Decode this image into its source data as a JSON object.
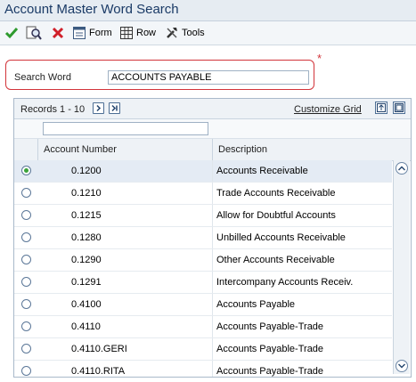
{
  "window": {
    "title": "Account Master Word Search"
  },
  "toolbar": {
    "form_label": "Form",
    "row_label": "Row",
    "tools_label": "Tools"
  },
  "search": {
    "label": "Search Word",
    "value": "ACCOUNTS PAYABLE",
    "required_marker": "*"
  },
  "grid": {
    "records_label": "Records 1 - 10",
    "customize_label": "Customize Grid",
    "columns": [
      "Account Number",
      "Description"
    ],
    "rows": [
      {
        "account": "0.1200",
        "description": "Accounts Receivable",
        "selected": true
      },
      {
        "account": "0.1210",
        "description": "Trade Accounts Receivable",
        "selected": false
      },
      {
        "account": "0.1215",
        "description": "Allow for Doubtful Accounts",
        "selected": false
      },
      {
        "account": "0.1280",
        "description": "Unbilled Accounts Receivable",
        "selected": false
      },
      {
        "account": "0.1290",
        "description": "Other Accounts Receivable",
        "selected": false
      },
      {
        "account": "0.1291",
        "description": "Intercompany Accounts Receiv.",
        "selected": false
      },
      {
        "account": "0.4100",
        "description": "Accounts Payable",
        "selected": false
      },
      {
        "account": "0.4110",
        "description": "Accounts Payable-Trade",
        "selected": false
      },
      {
        "account": "0.4110.GERI",
        "description": "Accounts Payable-Trade",
        "selected": false
      },
      {
        "account": "0.4110.RITA",
        "description": "Accounts Payable-Trade",
        "selected": false
      }
    ]
  },
  "colors": {
    "title": "#1a3a66",
    "required": "#d2343a",
    "selected_row": "#e4ebf4",
    "ok_check": "#2e9a2e",
    "cancel_x": "#d0202a"
  }
}
